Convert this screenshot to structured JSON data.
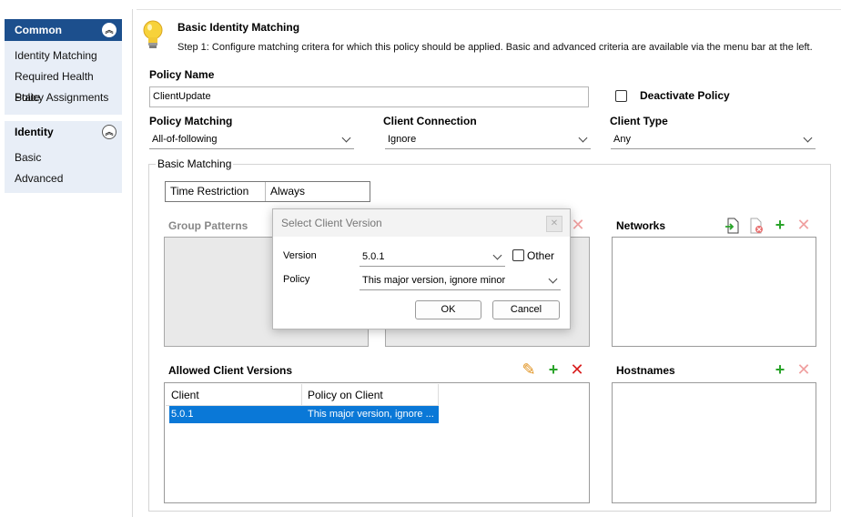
{
  "sidebar": {
    "groups": [
      {
        "title": "Common",
        "items": [
          "Identity Matching",
          "Required Health State",
          "Policy Assignments"
        ]
      },
      {
        "title": "Identity",
        "items": [
          "Basic",
          "Advanced"
        ]
      }
    ]
  },
  "header": {
    "title": "Basic Identity Matching",
    "subtitle": "Step 1: Configure matching critera for which this policy should be applied. Basic and advanced criteria are available via the menu bar at the left."
  },
  "form": {
    "policy_name_label": "Policy Name",
    "policy_name_value": "ClientUpdate",
    "deactivate_label": "Deactivate Policy",
    "deactivate_checked": false,
    "policy_matching_label": "Policy Matching",
    "policy_matching_value": "All-of-following",
    "client_connection_label": "Client Connection",
    "client_connection_value": "Ignore",
    "client_type_label": "Client Type",
    "client_type_value": "Any"
  },
  "basic_matching": {
    "legend": "Basic Matching",
    "time_restriction_label": "Time Restriction",
    "time_restriction_value": "Always",
    "group_patterns_title": "Group Patterns",
    "networks_title": "Networks",
    "allowed_versions_title": "Allowed Client Versions",
    "hostnames_title": "Hostnames",
    "grid": {
      "columns": [
        "Client",
        "Policy on Client"
      ],
      "rows": [
        {
          "client": "5.0.1",
          "policy": "This major version, ignore ..."
        }
      ]
    }
  },
  "dialog": {
    "title": "Select Client Version",
    "close_glyph": "✕",
    "version_label": "Version",
    "version_value": "5.0.1",
    "other_label": "Other",
    "policy_label": "Policy",
    "policy_value": "This major version, ignore minor",
    "ok_label": "OK",
    "cancel_label": "Cancel"
  },
  "colors": {
    "sidebar_active": "#1c4f8d",
    "sidebar_bg": "#e8eef7",
    "selection": "#0a78d7",
    "add_green": "#29a329",
    "remove_red": "#d92020",
    "edit_orange": "#e0901b"
  }
}
